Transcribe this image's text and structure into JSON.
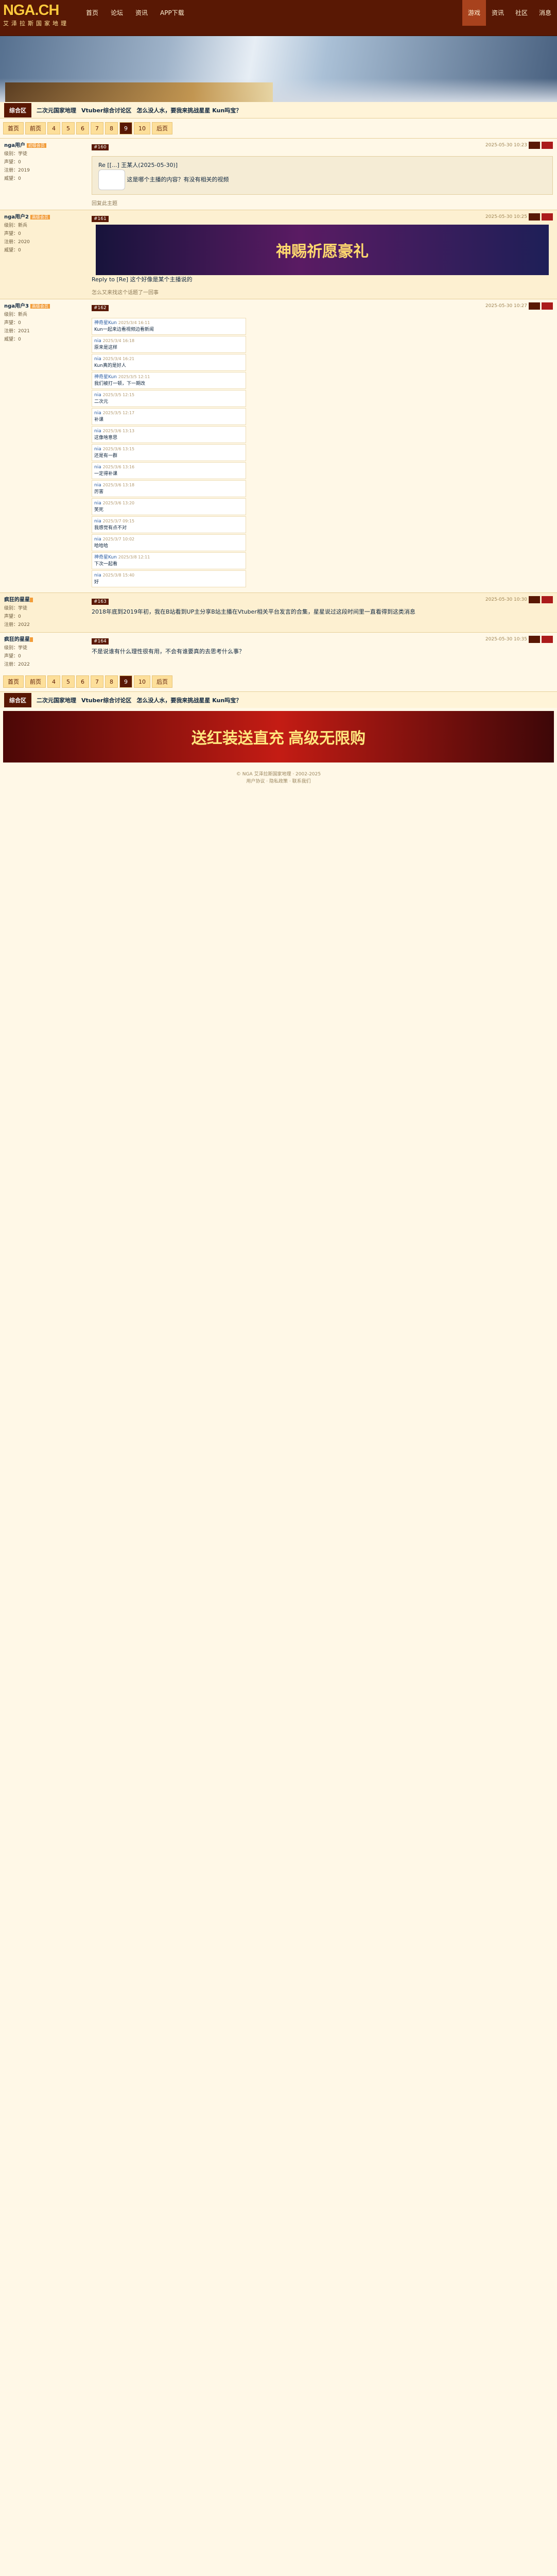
{
  "site": {
    "logo": "NGA.CH",
    "logo_sub": "艾泽拉斯国家地理"
  },
  "topnav": [
    "首页",
    "论坛",
    "资讯",
    "APP下载"
  ],
  "topright": [
    {
      "label": "游戏",
      "on": true
    },
    {
      "label": "资讯"
    },
    {
      "label": "社区"
    },
    {
      "label": "消息"
    }
  ],
  "crumb": {
    "forum": "综合区",
    "items": [
      "二次元国家地理",
      "Vtuber综合讨论区",
      "怎么没人水，要我来挑战星星 Kun吗宝？"
    ]
  },
  "pager": {
    "items": [
      "首页",
      "前页",
      "4",
      "5",
      "6",
      "7",
      "8",
      "9",
      "10",
      "后页"
    ],
    "current": "9"
  },
  "posts": [
    {
      "user": "nga用户",
      "level": "初级会员",
      "info": [
        "级别：学徒",
        "声望：0",
        "注册：2019",
        "威望：0"
      ],
      "floor": "#160",
      "date": "2025-05-30 10:23",
      "quote_user": "Re [[...] 王某人(2025-05-30)]",
      "text": "这是哪个主播的内容？有没有相关的视频",
      "sig": "回复此主题"
    },
    {
      "user": "nga用户2",
      "level": "高级会员",
      "info": [
        "级别：新兵",
        "声望：0",
        "注册：2020",
        "威望：0"
      ],
      "floor": "#161",
      "date": "2025-05-30 10:25",
      "text": "Reply to [Re] 这个好像是某个主播说的",
      "sig": "怎么又来找这个话题了一回事"
    },
    {
      "user": "nga用户3",
      "level": "高级会员",
      "info": [
        "级别：新兵",
        "声望：0",
        "注册：2021",
        "威望：0"
      ],
      "floor": "#162",
      "date": "2025-05-30 10:27",
      "text": ""
    },
    {
      "user": "疯狂的星星",
      "level": "",
      "info": [
        "级别：学徒",
        "声望：0",
        "注册：2022"
      ],
      "floor": "#163",
      "date": "2025-05-30 10:30",
      "text": "2018年底到2019年初，我在B站看到UP主分享B站主播在Vtuber相关平台发言的合集，星星说过这段时间里一直看得到这类消息",
      "sig": ""
    },
    {
      "user": "疯狂的星星",
      "level": "",
      "info": [
        "级别：学徒",
        "声望：0",
        "注册：2022"
      ],
      "floor": "#164",
      "date": "2025-05-30 10:35",
      "text": "不是说谁有什么理性很有用，不会有谁要真的去思考什么事？"
    }
  ],
  "ad1": "神赐祈愿豪礼",
  "ad2": "送红装送直充 高级无限购",
  "comments": [
    {
      "who": "神奇星Kun",
      "time": "2025/3/4 16:11",
      "text": "Kun一起来边看视频边看新闻"
    },
    {
      "who": "nia",
      "time": "2025/3/4 16:18",
      "text": "原来是这样"
    },
    {
      "who": "nia",
      "time": "2025/3/4 16:21",
      "text": "Kun真的是好人"
    },
    {
      "who": "神奇星Kun",
      "time": "2025/3/5 12:11",
      "text": "我们被打一顿，下一期改"
    },
    {
      "who": "nia",
      "time": "2025/3/5 12:15",
      "text": "二次元"
    },
    {
      "who": "nia",
      "time": "2025/3/5 12:17",
      "text": "补课"
    },
    {
      "who": "nia",
      "time": "2025/3/6 13:13",
      "text": "这像啥意思"
    },
    {
      "who": "nia",
      "time": "2025/3/6 13:15",
      "text": "还是有一群"
    },
    {
      "who": "nia",
      "time": "2025/3/6 13:16",
      "text": "一定得补课"
    },
    {
      "who": "nia",
      "time": "2025/3/6 13:18",
      "text": "厉害"
    },
    {
      "who": "nia",
      "time": "2025/3/6 13:20",
      "text": "笑死"
    },
    {
      "who": "nia",
      "time": "2025/3/7 09:15",
      "text": "我感觉有点不对"
    },
    {
      "who": "nia",
      "time": "2025/3/7 10:02",
      "text": "哈哈哈"
    },
    {
      "who": "神奇星Kun",
      "time": "2025/3/8 12:11",
      "text": "下次一起看"
    },
    {
      "who": "nia",
      "time": "2025/3/8 15:40",
      "text": "好"
    }
  ],
  "footer": [
    "© NGA 艾泽拉斯国家地理 · 2002-2025",
    "用户协议 · 隐私政策 · 联系我们"
  ],
  "reply_label": "回复"
}
